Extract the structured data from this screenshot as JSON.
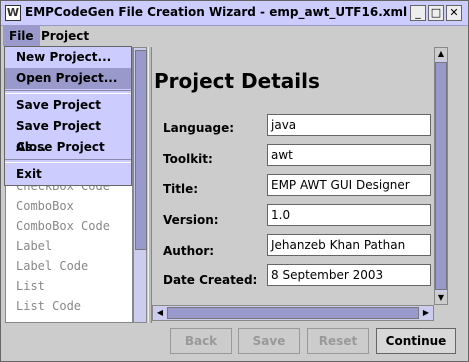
{
  "window": {
    "title": "EMPCodeGen File Creation Wizard - emp_awt_UTF16.xml",
    "icon": "W",
    "minimize": "_",
    "maximize": "□",
    "close": "✕"
  },
  "menubar": {
    "items": [
      "File",
      "Project"
    ]
  },
  "file_menu": {
    "items": [
      "New Project...",
      "Open Project...",
      "Save Project",
      "Save Project As...",
      "Close Project",
      "Exit"
    ],
    "selected": "Open Project..."
  },
  "component_list": {
    "items": [
      "CheckBox Code",
      "ComboBox",
      "ComboBox Code",
      "Label",
      "Label Code",
      "List",
      "List Code"
    ]
  },
  "project_details": {
    "heading": "Project Details",
    "fields": [
      {
        "label": "Language:",
        "value": "java"
      },
      {
        "label": "Toolkit:",
        "value": "awt"
      },
      {
        "label": "Title:",
        "value": "EMP AWT GUI Designer"
      },
      {
        "label": "Version:",
        "value": "1.0"
      },
      {
        "label": "Author:",
        "value": "Jehanzeb Khan Pathan"
      },
      {
        "label": "Date Created:",
        "value": "8 September 2003"
      }
    ]
  },
  "buttons": {
    "back": "Back",
    "save": "Save",
    "reset": "Reset",
    "continue": "Continue"
  },
  "colors": {
    "title_bar": "#ccccff",
    "menu_highlight": "#9999cc",
    "scroll_thumb": "#9999cc"
  }
}
